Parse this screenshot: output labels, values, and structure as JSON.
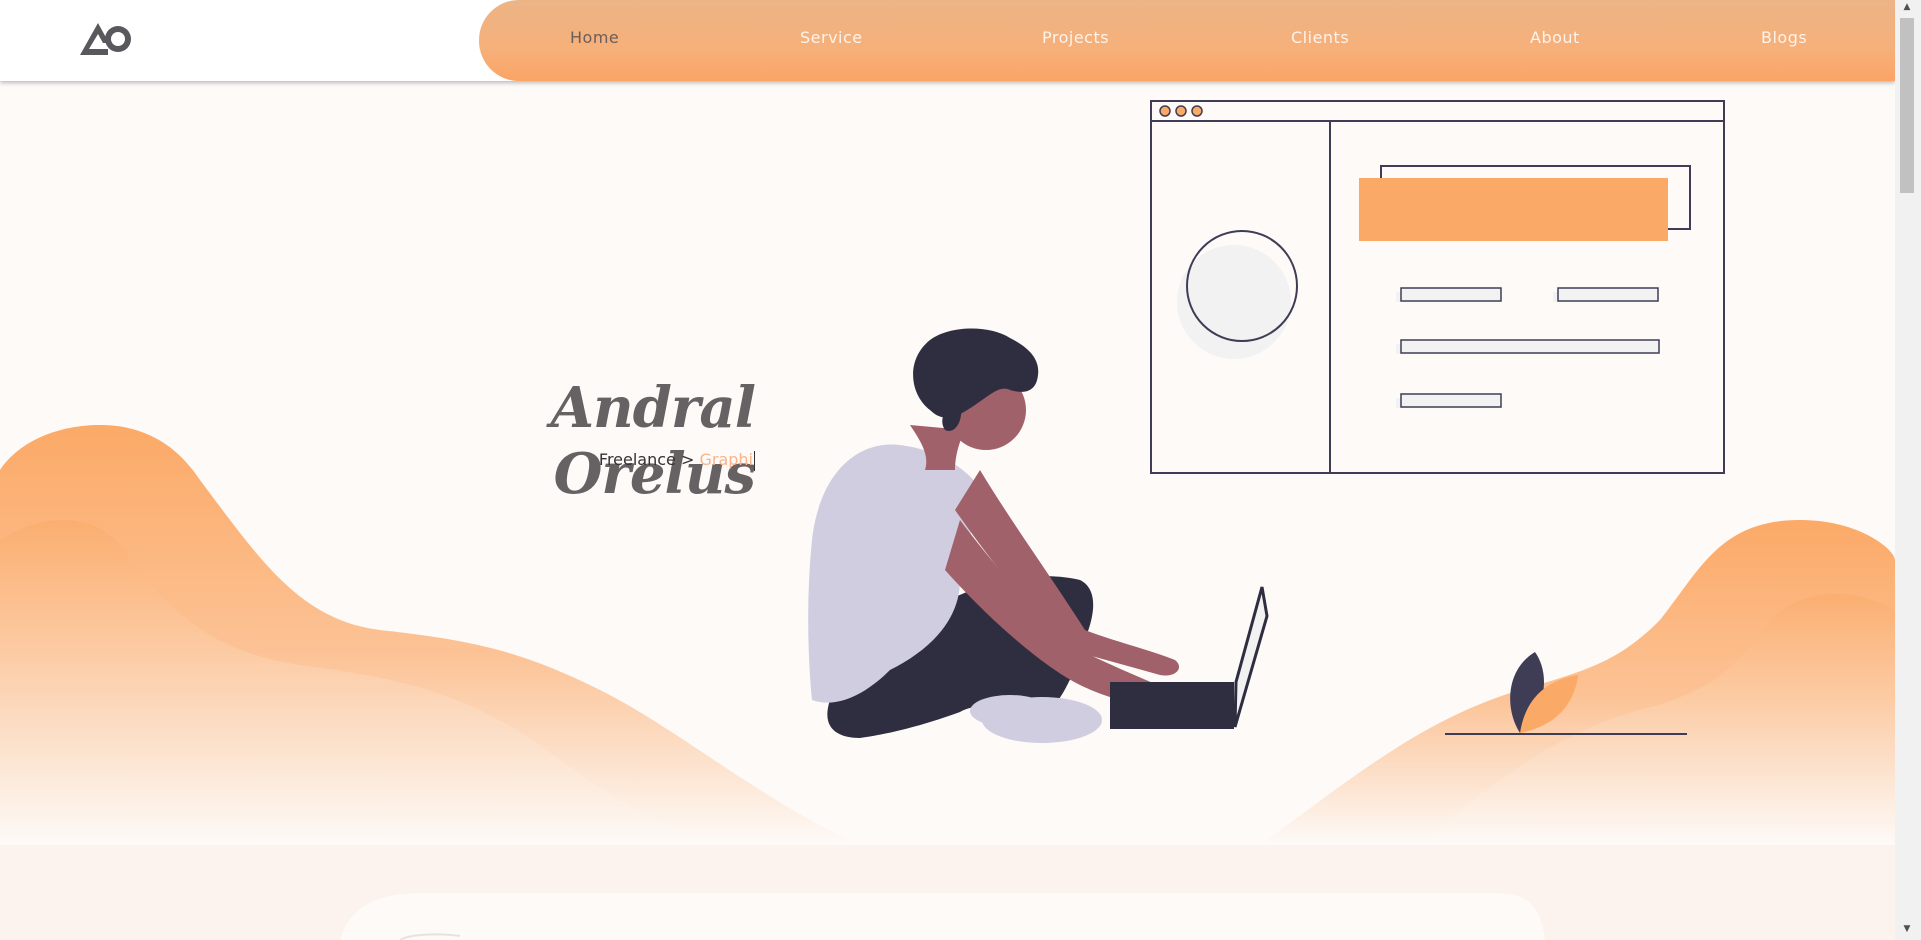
{
  "logo": {
    "alt": "AO"
  },
  "nav": {
    "items": [
      {
        "label": "Home",
        "active": true
      },
      {
        "label": "Service"
      },
      {
        "label": "Projects"
      },
      {
        "label": "Clients"
      },
      {
        "label": "About"
      },
      {
        "label": "Blogs"
      }
    ]
  },
  "hero": {
    "name": "Andral Orelus",
    "subtitle_prefix": "Freelance > ",
    "subtitle_typed": "Graphi"
  },
  "colors": {
    "accent": "#fba966",
    "dark": "#2f2e41",
    "skin": "#a0616a",
    "shirt": "#d0cde1",
    "background": "#fdfaf8"
  },
  "icons": [
    "logo-icon",
    "scroll-up-arrow-icon",
    "scroll-down-arrow-icon"
  ]
}
